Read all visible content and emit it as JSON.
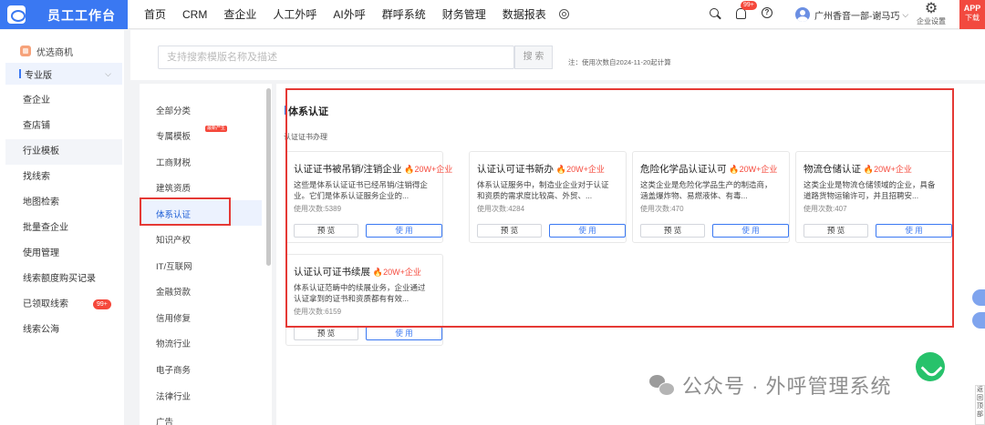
{
  "app": {
    "title": "员工工作台",
    "brand_color": "#3a78f2"
  },
  "nav": [
    "首页",
    "CRM",
    "查企业",
    "人工外呼",
    "AI外呼",
    "群呼系统",
    "财务管理",
    "数据报表"
  ],
  "header": {
    "notification_badge": "99+",
    "help_icon": "?",
    "user_name": "广州香音一部-谢马巧",
    "settings_label": "企业设置",
    "app_label": "APP",
    "download_label": "下载"
  },
  "sidebar": {
    "promo": "优选商机",
    "edition": "专业版",
    "items": [
      {
        "label": "查企业"
      },
      {
        "label": "查店铺"
      },
      {
        "label": "行业模板"
      },
      {
        "label": "找线索"
      },
      {
        "label": "地图检索"
      },
      {
        "label": "批量查企业"
      },
      {
        "label": "使用管理"
      },
      {
        "label": "线索额度购买记录"
      },
      {
        "label": "已领取线索",
        "badge": "99+"
      },
      {
        "label": "线索公海"
      }
    ]
  },
  "search": {
    "placeholder": "支持搜索模版名称及描述",
    "button": "搜 索",
    "note": "注：使用次数自2024-11-20起计算"
  },
  "categories": {
    "items": [
      "全部分类",
      "专属模板",
      "工商财税",
      "建筑资质",
      "体系认证",
      "知识产权",
      "IT/互联网",
      "金融贷款",
      "信用修复",
      "物流行业",
      "电子商务",
      "法律行业",
      "广告"
    ],
    "active": "体系认证",
    "mark": "最新产生"
  },
  "section": {
    "title": "体系认证",
    "subtitle": "认证证书办理"
  },
  "cards": [
    {
      "title": "认证证书被吊销/注销企业",
      "hot": "🔥20W+企业",
      "desc": "这些是体系认证证书已经吊销/注销得企业。它们是体系认证服务企业的...",
      "usage": "使用次数:5389",
      "preview": "预 览",
      "use": "使 用"
    },
    {
      "title": "认证认可证书新办",
      "hot": "🔥20W+企业",
      "desc": "体系认证服务中，制造业企业对于认证和资质的需求度比较高、外贸、...",
      "usage": "使用次数:4284",
      "preview": "预 览",
      "use": "使 用"
    },
    {
      "title": "危险化学品认证认可",
      "hot": "🔥20W+企业",
      "desc": "这类企业是危险化学品生产的制造商，涵盖爆炸物、易燃液体、有毒...",
      "usage": "使用次数:470",
      "preview": "预 览",
      "use": "使 用"
    },
    {
      "title": "物流仓储认证",
      "hot": "🔥20W+企业",
      "desc": "这类企业是物流仓储领域的企业，具备道路货物运输许可，并且招聘安...",
      "usage": "使用次数:407",
      "preview": "预 览",
      "use": "使 用"
    },
    {
      "title": "认证认可证书续展",
      "hot": "🔥20W+企业",
      "desc": "体系认证范畴中的续展业务，企业通过认证拿到的证书和资质都有有效...",
      "usage": "使用次数:6159",
      "preview": "预 览",
      "use": "使 用"
    }
  ],
  "side_tab": "返回顶部",
  "watermark": "公众号 · 外呼管理系统"
}
